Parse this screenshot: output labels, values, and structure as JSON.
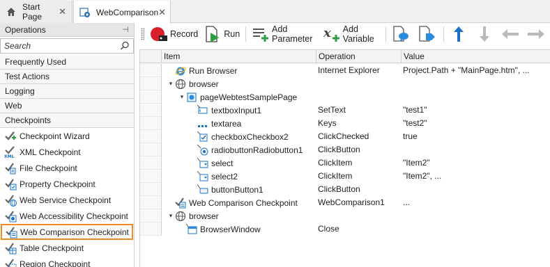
{
  "tabs": [
    {
      "label": "Start Page",
      "icon": "home-icon"
    },
    {
      "label": "WebComparison",
      "icon": "web-test-icon"
    }
  ],
  "operations_panel": {
    "title": "Operations",
    "search_placeholder": "Search",
    "categories": [
      "Frequently Used",
      "Test Actions",
      "Logging",
      "Web",
      "Checkpoints"
    ],
    "items": [
      {
        "label": "Checkpoint Wizard",
        "icon": "checkpoint-wizard-icon"
      },
      {
        "label": "XML Checkpoint",
        "icon": "xml-checkpoint-icon"
      },
      {
        "label": "File Checkpoint",
        "icon": "file-checkpoint-icon"
      },
      {
        "label": "Property Checkpoint",
        "icon": "property-checkpoint-icon"
      },
      {
        "label": "Web Service Checkpoint",
        "icon": "web-service-checkpoint-icon"
      },
      {
        "label": "Web Accessibility Checkpoint",
        "icon": "web-accessibility-checkpoint-icon"
      },
      {
        "label": "Web Comparison Checkpoint",
        "icon": "web-comparison-checkpoint-icon"
      },
      {
        "label": "Table Checkpoint",
        "icon": "table-checkpoint-icon"
      },
      {
        "label": "Region Checkpoint",
        "icon": "region-checkpoint-icon"
      }
    ]
  },
  "toolbar": {
    "record": "Record",
    "run": "Run",
    "add_parameter": "Add Parameter",
    "add_variable": "Add Variable"
  },
  "grid": {
    "columns": [
      "Item",
      "Operation",
      "Value"
    ],
    "rows": [
      {
        "indent": 0,
        "expander": "",
        "icon": "ie-icon",
        "item": "Run Browser",
        "operation": "Internet Explorer",
        "value": "Project.Path + \"MainPage.htm\", ..."
      },
      {
        "indent": 0,
        "expander": "▾",
        "icon": "globe-icon",
        "item": "browser",
        "operation": "",
        "value": ""
      },
      {
        "indent": 1,
        "expander": "▾",
        "icon": "page-icon",
        "item": "pageWebtestSamplePage",
        "operation": "",
        "value": ""
      },
      {
        "indent": 2,
        "expander": "",
        "icon": "textbox-icon",
        "item": "textboxInput1",
        "operation": "SetText",
        "value": "\"test1\""
      },
      {
        "indent": 2,
        "expander": "",
        "icon": "textarea-icon",
        "item": "textarea",
        "operation": "Keys",
        "value": "\"test2\""
      },
      {
        "indent": 2,
        "expander": "",
        "icon": "checkbox-icon",
        "item": "checkboxCheckbox2",
        "operation": "ClickChecked",
        "value": "true"
      },
      {
        "indent": 2,
        "expander": "",
        "icon": "radio-icon",
        "item": "radiobuttonRadiobutton1",
        "operation": "ClickButton",
        "value": ""
      },
      {
        "indent": 2,
        "expander": "",
        "icon": "select-icon",
        "item": "select",
        "operation": "ClickItem",
        "value": "\"Item2\""
      },
      {
        "indent": 2,
        "expander": "",
        "icon": "select-icon",
        "item": "select2",
        "operation": "ClickItem",
        "value": "\"Item2\", ..."
      },
      {
        "indent": 2,
        "expander": "",
        "icon": "button-icon",
        "item": "buttonButton1",
        "operation": "ClickButton",
        "value": ""
      },
      {
        "indent": 0,
        "expander": "",
        "icon": "web-comparison-checkpoint-icon",
        "item": "Web Comparison Checkpoint",
        "operation": "WebComparison1",
        "value": "..."
      },
      {
        "indent": 0,
        "expander": "▾",
        "icon": "globe-icon",
        "item": "browser",
        "operation": "",
        "value": ""
      },
      {
        "indent": 1,
        "expander": "",
        "icon": "window-icon",
        "item": "BrowserWindow",
        "operation": "Close",
        "value": ""
      }
    ]
  },
  "colors": {
    "highlight": "#f08a24",
    "run_green": "#2ea043",
    "record_red": "#d9202a",
    "icon_blue": "#1a73c8"
  }
}
